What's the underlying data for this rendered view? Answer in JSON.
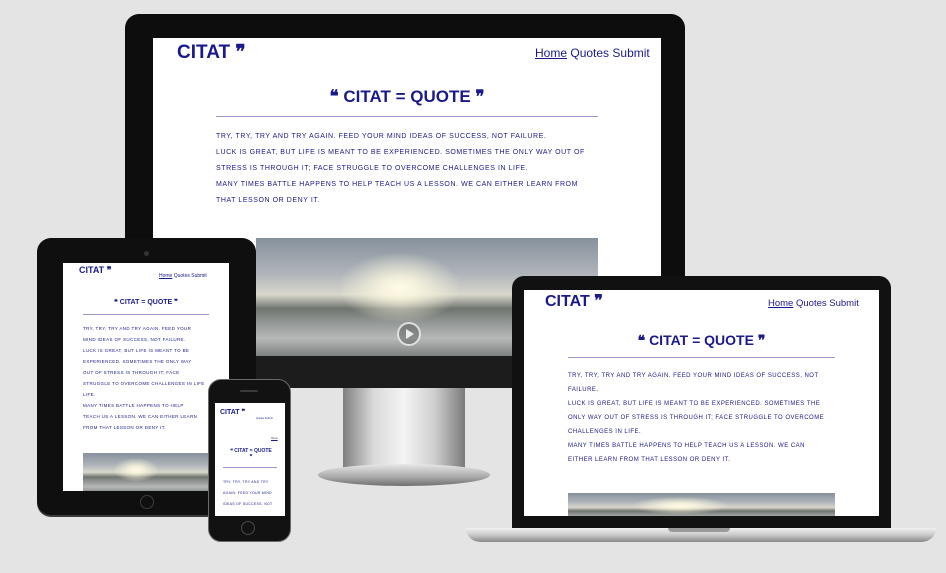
{
  "site": {
    "brand": "CITAT",
    "brand_mark": "❞",
    "nav": [
      "Home",
      "Quotes",
      "Submit"
    ],
    "heading_open": "❝",
    "heading_text": "CITAT = QUOTE",
    "heading_close": "❞",
    "quotes": [
      "Try, try, try and try again. Feed your mind ideas of success, not failure.",
      "Luck is great, but life is meant to be experienced. Sometimes the only way out of stress is through it; face struggle to overcome challenges in life.",
      "Many times battle happens to help teach us a lesson. We can either learn from that lesson or deny it."
    ]
  },
  "desktop_lines": [
    "Try, try, try and try again. Feed your mind ideas of success, not failure.",
    "Luck is great, but life is meant to be experienced. Sometimes the only way out of",
    "stress is through it; face struggle to overcome challenges in life.",
    "Many times battle happens to help teach us a lesson. We can either learn from",
    "that lesson or deny it."
  ],
  "laptop_lines": [
    "Try, try, try and try again. Feed your mind ideas of success, not",
    "failure.",
    "Luck is great, but life is meant to be experienced. Sometimes the",
    "only way out of stress is through it; face struggle to overcome",
    "challenges in life.",
    "Many times battle happens to help teach us a lesson. We can",
    "either learn from that lesson or deny it."
  ],
  "tablet_lines": [
    "Try, try, try and try again. Feed your",
    "mind ideas of success, not failure.",
    "Luck is great, but life is meant to be",
    "experienced. Sometimes the only way",
    "out of stress is through it; face",
    "struggle to overcome challenges in life",
    "life.",
    "Many times battle happens to help",
    "teach us a lesson. We can either learn",
    "from that lesson or deny it."
  ],
  "phone_heading_lines": [
    "❝ CITAT = QUOTE",
    "❞"
  ],
  "phone_lines": [
    "Try, try, try and try",
    "again. Feed your mind",
    "ideas of success, not"
  ],
  "colors": {
    "brand": "#1a1a8c",
    "background": "#e4e4e4",
    "bezel": "#0d0d0d"
  }
}
